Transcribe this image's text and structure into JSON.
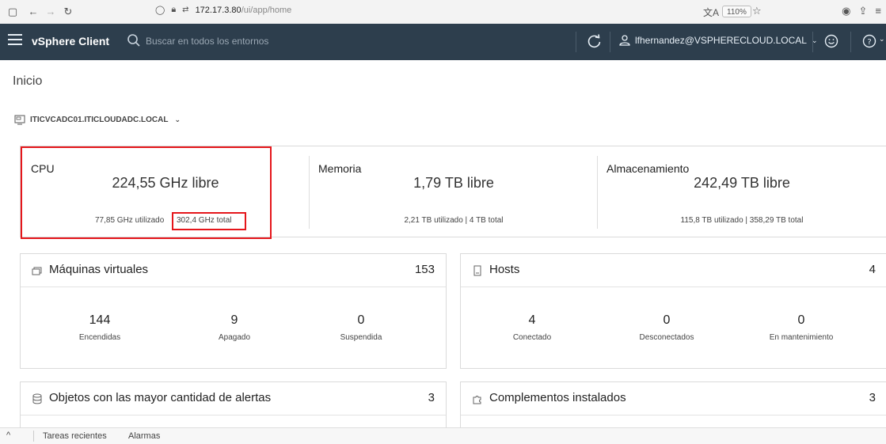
{
  "browser": {
    "url_host": "172.17.3.80",
    "url_path": "/ui/app/home",
    "zoom": "110%"
  },
  "header": {
    "app_title": "vSphere Client",
    "search_placeholder": "Buscar en todos los entornos",
    "user": "lfhernandez@VSPHERECLOUD.LOCAL"
  },
  "page": {
    "title": "Inicio",
    "vcenter": "ITICVCADC01.ITICLOUDADC.LOCAL"
  },
  "summary": {
    "cpu": {
      "title": "CPU",
      "free": "224,55 GHz libre",
      "used": "77,85 GHz utilizado",
      "total": "302,4 GHz total"
    },
    "memory": {
      "title": "Memoria",
      "free": "1,79 TB libre",
      "detail": "2,21 TB utilizado | 4 TB total"
    },
    "storage": {
      "title": "Almacenamiento",
      "free": "242,49 TB libre",
      "detail": "115,8 TB utilizado | 358,29 TB total"
    }
  },
  "vms": {
    "title": "Máquinas virtuales",
    "count": "153",
    "stats": [
      {
        "value": "144",
        "label": "Encendidas"
      },
      {
        "value": "9",
        "label": "Apagado"
      },
      {
        "value": "0",
        "label": "Suspendida"
      }
    ]
  },
  "hosts": {
    "title": "Hosts",
    "count": "4",
    "stats": [
      {
        "value": "4",
        "label": "Conectado"
      },
      {
        "value": "0",
        "label": "Desconectados"
      },
      {
        "value": "0",
        "label": "En mantenimiento"
      }
    ]
  },
  "alerts": {
    "title": "Objetos con las mayor cantidad de alertas",
    "count": "3"
  },
  "plugins": {
    "title": "Complementos instalados",
    "count": "3"
  },
  "bottom": {
    "recent_tasks": "Tareas recientes",
    "alarms": "Alarmas"
  },
  "colors": {
    "header_bg": "#2d3e4d",
    "highlight": "#e5161b"
  }
}
